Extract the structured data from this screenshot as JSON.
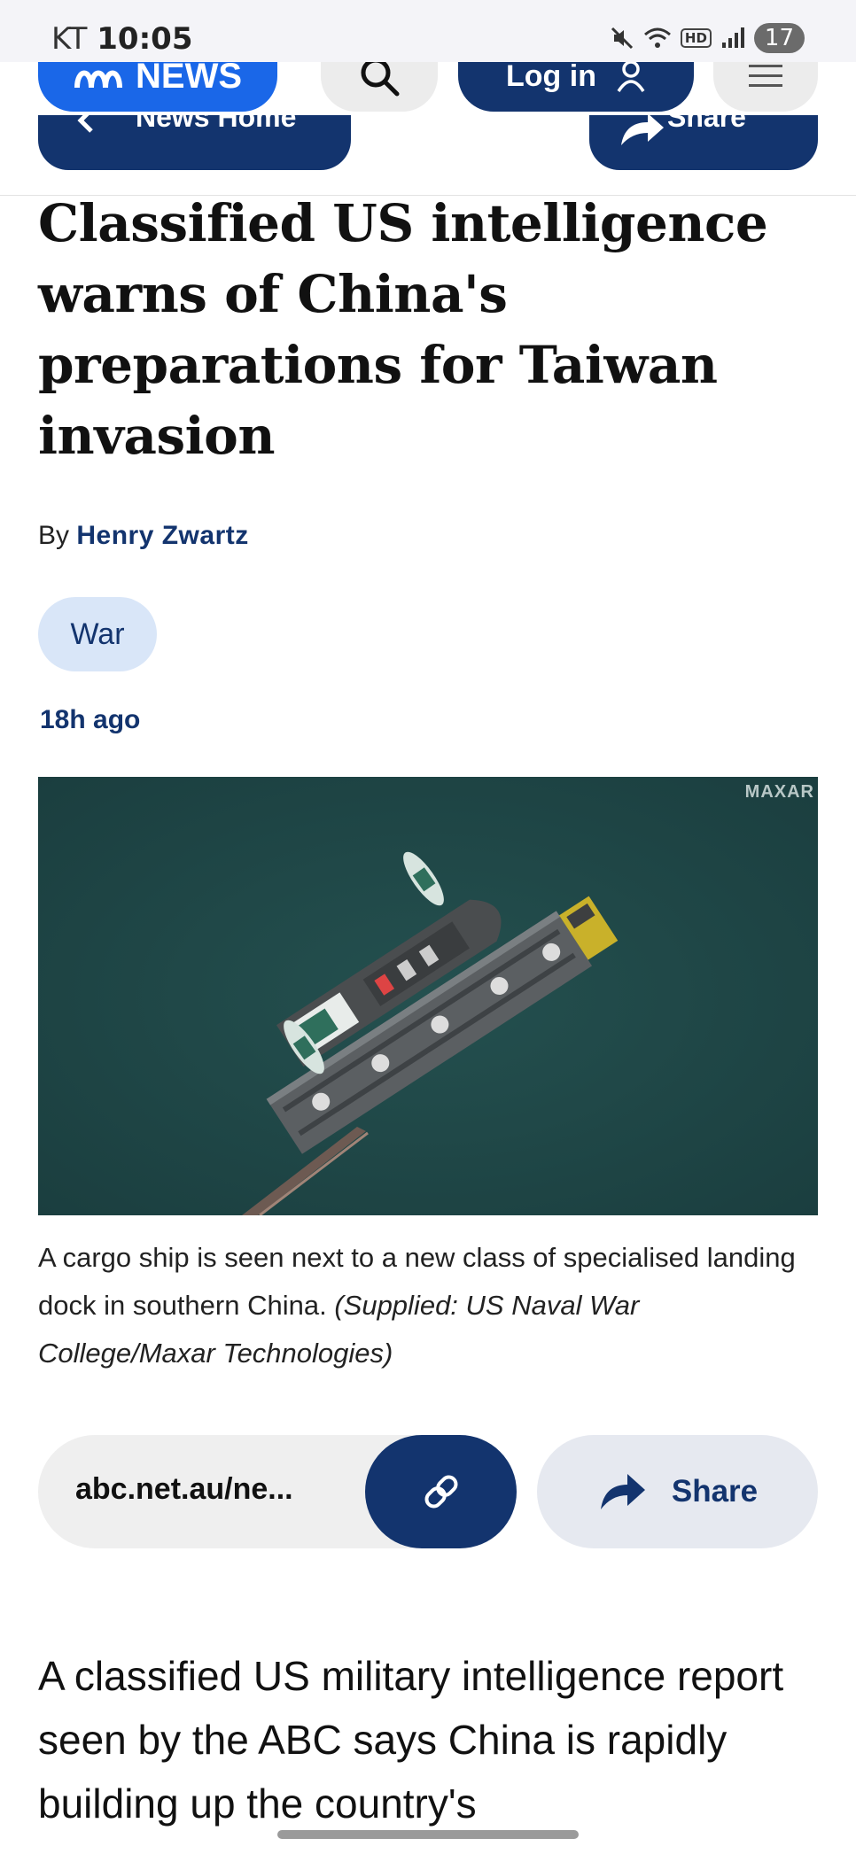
{
  "status_bar": {
    "carrier": "KT",
    "time": "10:05",
    "hd": "HD",
    "battery": "17"
  },
  "header": {
    "logo": "NEWS",
    "login_label": "Log in",
    "subnav_home": "News Home",
    "subnav_share": "Share"
  },
  "article": {
    "headline": "Classified US intelligence warns of China's preparations for Taiwan invasion",
    "byline_prefix": "By",
    "author": "Henry Zwartz",
    "tag": "War",
    "timestamp": "18h ago",
    "image_watermark": "MAXAR",
    "caption": "A cargo ship is seen next to a new class of specialised landing dock in southern China.",
    "caption_credit": "(Supplied: US Naval War College/Maxar Technologies)",
    "body_text": "A classified US military intelligence report seen by the ABC says China is rapidly building up the country's"
  },
  "share_row": {
    "url": "abc.net.au/ne...",
    "share_label": "Share"
  },
  "colors": {
    "abc_blue": "#1a67e8",
    "navy": "#13346e",
    "tag_bg": "#d9e6f8"
  }
}
